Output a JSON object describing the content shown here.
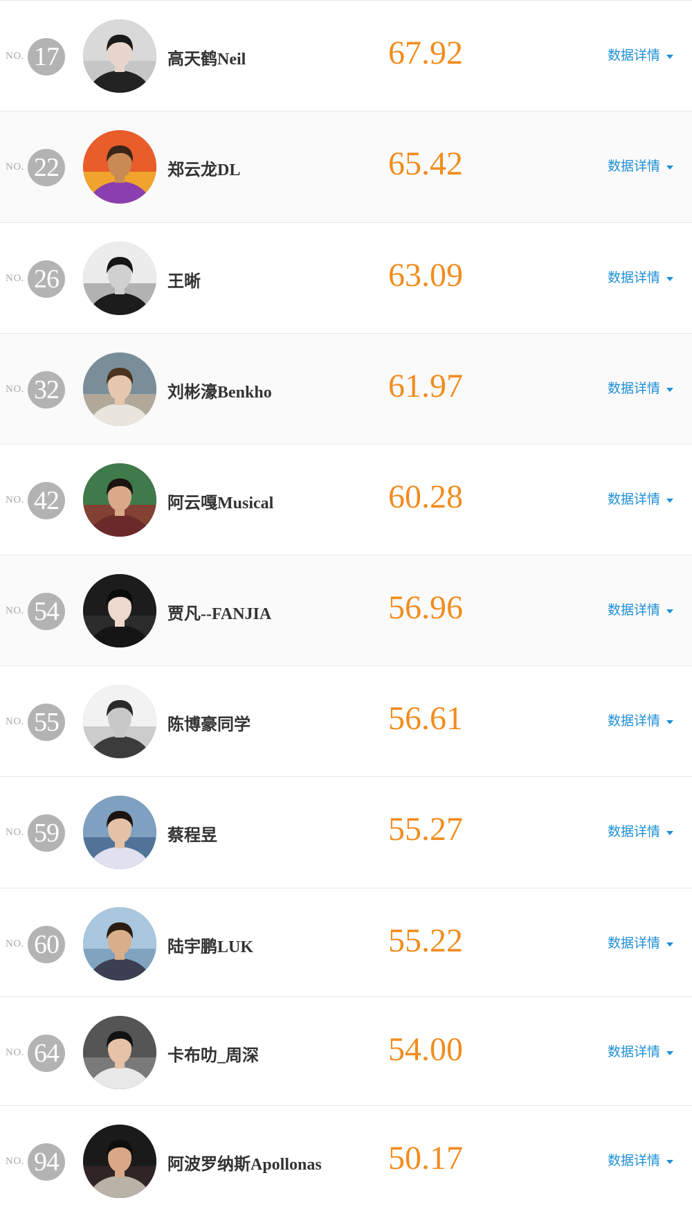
{
  "no_prefix": "NO.",
  "detail_label": "数据详情",
  "rows": [
    {
      "rank": "17",
      "name": "高天鹤Neil",
      "score": "67.92",
      "avatar": "man-portrait-dark-jacket"
    },
    {
      "rank": "22",
      "name": "郑云龙DL",
      "score": "65.42",
      "avatar": "man-portrait-colorful"
    },
    {
      "rank": "26",
      "name": "王晰",
      "score": "63.09",
      "avatar": "man-standing-bw"
    },
    {
      "rank": "32",
      "name": "刘彬濠Benkho",
      "score": "61.97",
      "avatar": "child-photo-vintage"
    },
    {
      "rank": "42",
      "name": "阿云嘎Musical",
      "score": "60.28",
      "avatar": "man-portrait-green-bg"
    },
    {
      "rank": "54",
      "name": "贾凡--FANJIA",
      "score": "56.96",
      "avatar": "man-portrait-dark-bg"
    },
    {
      "rank": "55",
      "name": "陈博豪同学",
      "score": "56.61",
      "avatar": "man-portrait-blurred-bw"
    },
    {
      "rank": "59",
      "name": "蔡程昱",
      "score": "55.27",
      "avatar": "man-portrait-window"
    },
    {
      "rank": "60",
      "name": "陆宇鹏LUK",
      "score": "55.22",
      "avatar": "child-beach-photo"
    },
    {
      "rank": "64",
      "name": "卡布叻_周深",
      "score": "54.00",
      "avatar": "man-portrait-patterned-shirt"
    },
    {
      "rank": "94",
      "name": "阿波罗纳斯Apollonas",
      "score": "50.17",
      "avatar": "man-portrait-beard-suit"
    }
  ]
}
